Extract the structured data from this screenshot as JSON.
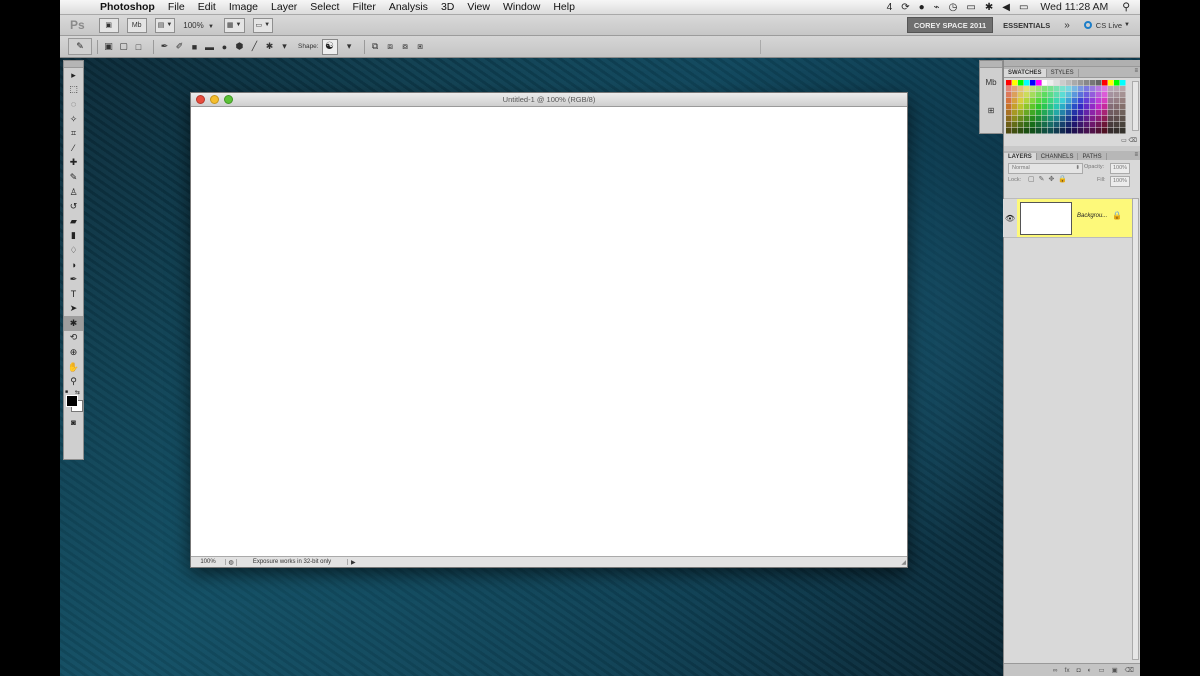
{
  "menubar": {
    "app_name": "Photoshop",
    "items": [
      "File",
      "Edit",
      "Image",
      "Layer",
      "Select",
      "Filter",
      "Analysis",
      "3D",
      "View",
      "Window",
      "Help"
    ],
    "status_icons": [
      "4",
      "⟳",
      "●",
      "⌁",
      "◷",
      "▭",
      "✱",
      "◀",
      "▭"
    ],
    "clock": "Wed 11:28 AM"
  },
  "appbar": {
    "logo": "Ps",
    "mb_label": "Mb",
    "zoom": "100%",
    "workspace_active": "COREY SPACE 2011",
    "workspace_essentials": "ESSENTIALS",
    "more": "»",
    "cs_live": "CS Live"
  },
  "options": {
    "shape_label": "Shape:"
  },
  "document": {
    "title": "Untitled-1 @ 100% (RGB/8)",
    "zoom": "100%",
    "status_message": "Exposure works in 32-bit only"
  },
  "panels": {
    "swatches_tabs": [
      "SWATCHES",
      "STYLES"
    ],
    "layers_tabs": [
      "LAYERS",
      "CHANNELS",
      "PATHS"
    ],
    "blend_mode": "Normal",
    "opacity_label": "Opacity:",
    "opacity_value": "100%",
    "lock_label": "Lock:",
    "fill_label": "Fill:",
    "fill_value": "100%",
    "layer_name": "Backgrou...",
    "swatch_colors": [
      "#ff0000",
      "#ffff00",
      "#00ff00",
      "#00ffff",
      "#0000ff",
      "#ff00ff",
      "#ffffff",
      "#eeeeee",
      "#dddddd",
      "#cccccc",
      "#bbbbbb",
      "#aaaaaa",
      "#999999",
      "#888888",
      "#777777",
      "#666666"
    ]
  },
  "colors": {
    "accent_layer": "#fdf97a",
    "foreground": "#000000",
    "background": "#ffffff"
  }
}
